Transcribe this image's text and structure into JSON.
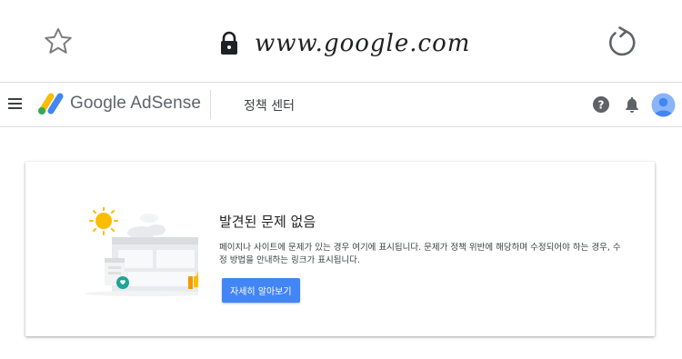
{
  "browser": {
    "url": "www.google.com",
    "icons": {
      "favorite": "star-outline-icon",
      "secure": "lock-icon",
      "reload": "reload-icon"
    }
  },
  "header": {
    "menu_icon": "hamburger-menu-icon",
    "logo_icon": "adsense-logo-icon",
    "product_name": "Google AdSense",
    "section_title": "정책 센터",
    "help_icon": "help-icon",
    "notifications_icon": "bell-icon",
    "avatar_icon": "account-avatar-icon"
  },
  "card": {
    "title": "발견된 문제 없음",
    "description": "페이지나 사이트에 문제가 있는 경우 여기에 표시됩니다. 문제가 정책 위반에 해당하며 수정되어야 하는 경우, 수정 방법을 안내하는 링크가 표시됩니다.",
    "button_label": "자세히 알아보기",
    "illustration_icon": "no-issues-illustration"
  },
  "colors": {
    "primary_button": "#4285f4",
    "logo_blue": "#4285f4",
    "logo_yellow": "#fbbc04",
    "logo_green": "#34a853",
    "avatar_blue": "#8ab4f8",
    "sun": "#fbbc04",
    "badge_teal": "#1fa59a"
  }
}
